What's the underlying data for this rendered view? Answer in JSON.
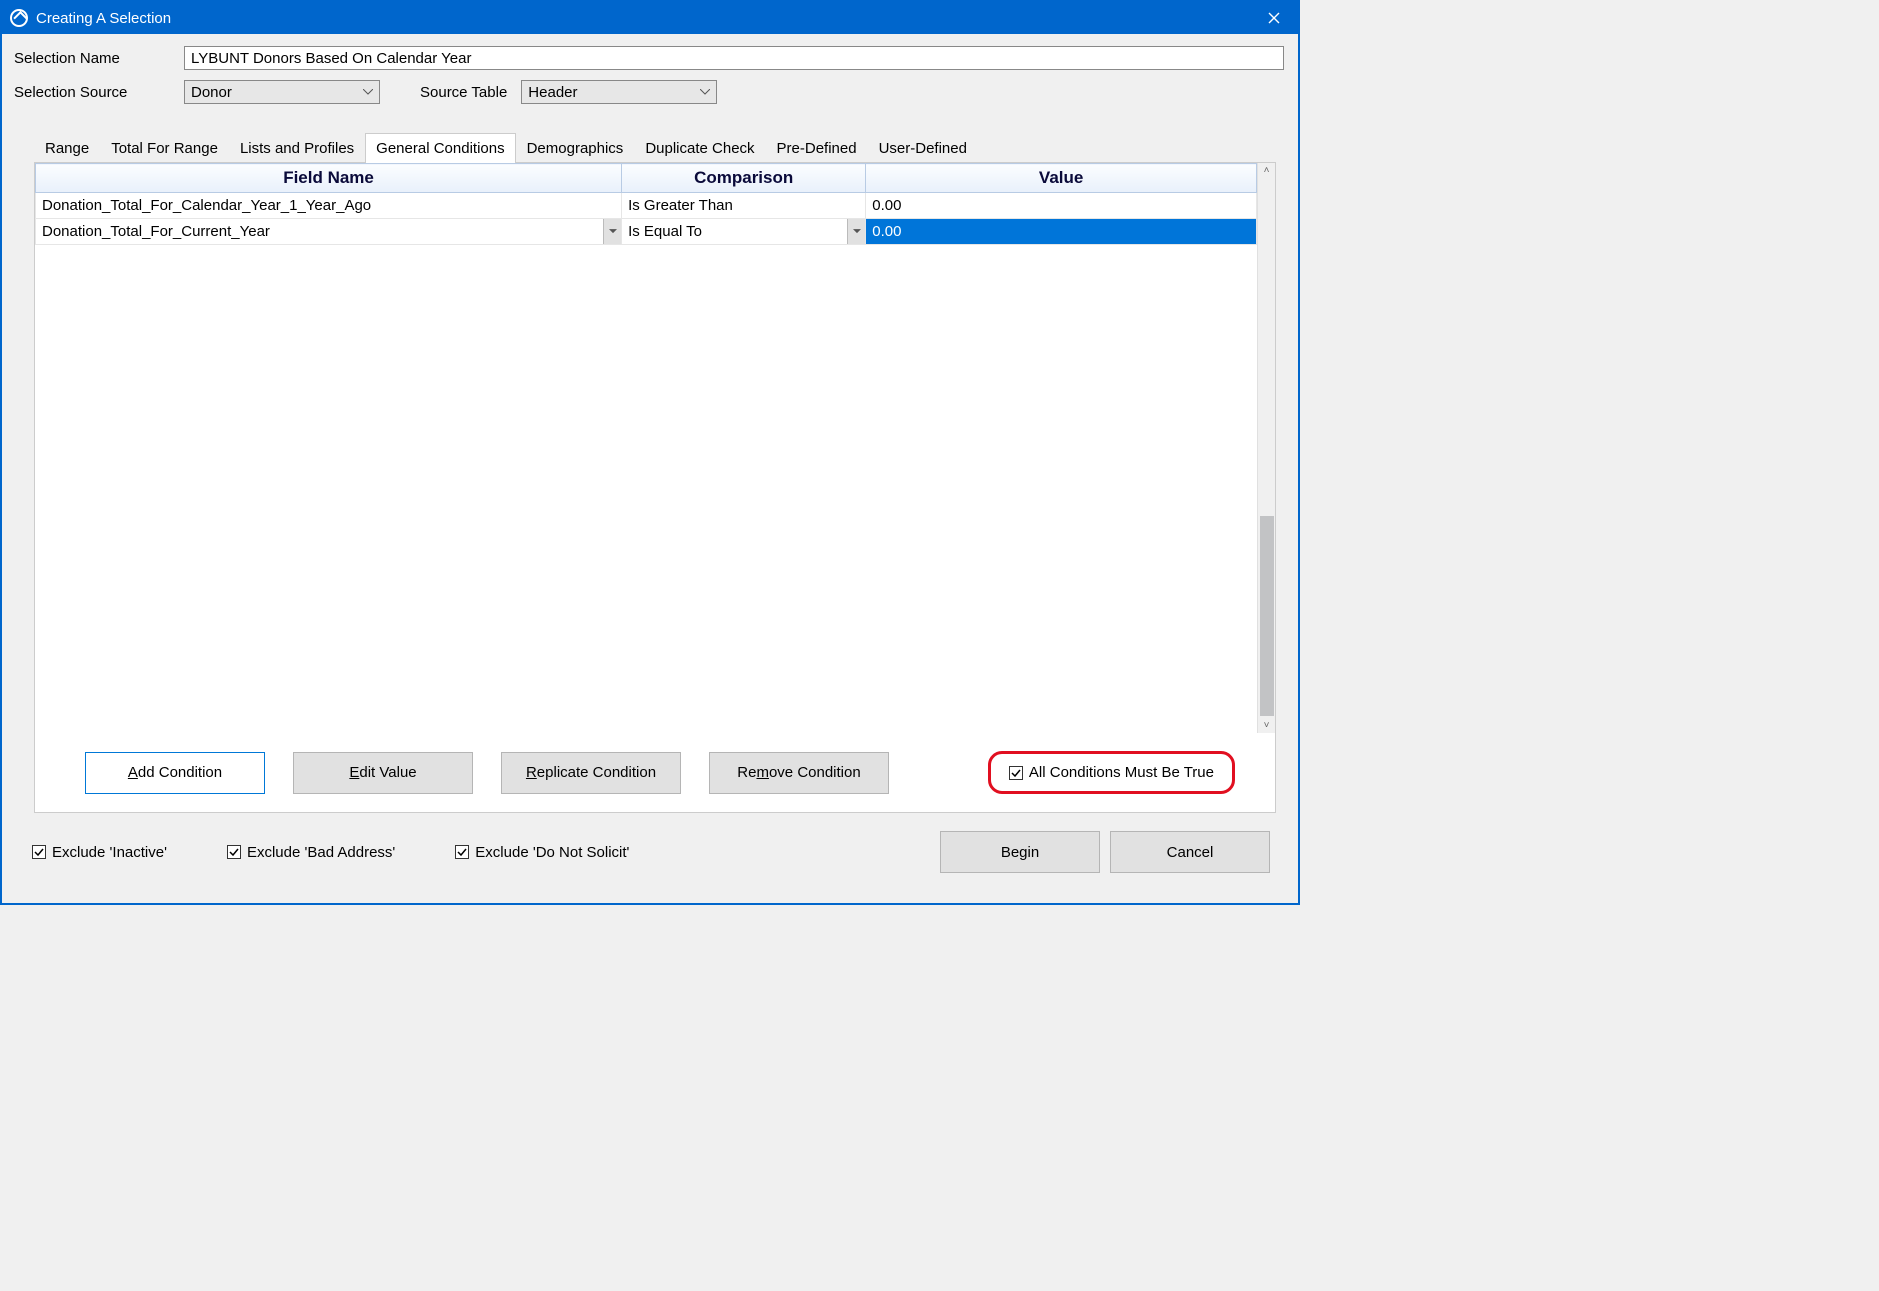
{
  "window": {
    "title": "Creating A Selection"
  },
  "form": {
    "name_label": "Selection Name",
    "name_value": "LYBUNT Donors Based On Calendar Year",
    "source_label": "Selection Source",
    "source_value": "Donor",
    "table_label": "Source Table",
    "table_value": "Header"
  },
  "tabs": [
    {
      "label": "Range"
    },
    {
      "label": "Total For Range"
    },
    {
      "label": "Lists and Profiles"
    },
    {
      "label": "General Conditions",
      "active": true
    },
    {
      "label": "Demographics"
    },
    {
      "label": "Duplicate Check"
    },
    {
      "label": "Pre-Defined"
    },
    {
      "label": "User-Defined"
    }
  ],
  "grid": {
    "headers": {
      "field": "Field Name",
      "comparison": "Comparison",
      "value": "Value"
    },
    "rows": [
      {
        "field": "Donation_Total_For_Calendar_Year_1_Year_Ago",
        "comparison": "Is Greater Than",
        "value": "0.00",
        "editing": false
      },
      {
        "field": "Donation_Total_For_Current_Year",
        "comparison": "Is Equal To",
        "value": "0.00",
        "editing": true
      }
    ]
  },
  "buttons": {
    "add": "Add Condition",
    "edit": "Edit Value",
    "replicate": "Replicate Condition",
    "remove": "Remove Condition",
    "all_true": "All Conditions Must Be True"
  },
  "footer": {
    "exclude_inactive": "Exclude 'Inactive'",
    "exclude_bad_address": "Exclude 'Bad Address'",
    "exclude_dns": "Exclude 'Do Not Solicit'",
    "begin": "Begin",
    "cancel": "Cancel"
  }
}
